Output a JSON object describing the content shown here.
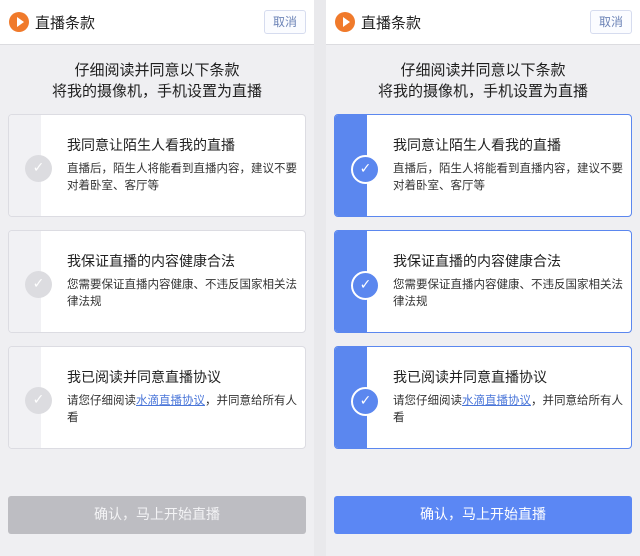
{
  "screens": [
    {
      "state": "unchecked",
      "header": {
        "title": "直播条款",
        "cancel_label": "取消"
      },
      "intro": [
        "仔细阅读并同意以下条款",
        "将我的摄像机，手机设置为直播"
      ],
      "items": [
        {
          "title": "我同意让陌生人看我的直播",
          "desc": "直播后，陌生人将能看到直播内容，建议不要对着卧室、客厅等",
          "checked": false
        },
        {
          "title": "我保证直播的内容健康合法",
          "desc": "您需要保证直播内容健康、不违反国家相关法律法规",
          "checked": false
        },
        {
          "title": "我已阅读并同意直播协议",
          "desc_before": "请您仔细阅读",
          "link": "水滴直播协议",
          "desc_after": "，并同意给所有人看",
          "checked": false
        }
      ],
      "confirm_label": "确认，马上开始直播"
    },
    {
      "state": "checked",
      "header": {
        "title": "直播条款",
        "cancel_label": "取消"
      },
      "intro": [
        "仔细阅读并同意以下条款",
        "将我的摄像机，手机设置为直播"
      ],
      "items": [
        {
          "title": "我同意让陌生人看我的直播",
          "desc": "直播后，陌生人将能看到直播内容，建议不要对着卧室、客厅等",
          "checked": true
        },
        {
          "title": "我保证直播的内容健康合法",
          "desc": "您需要保证直播内容健康、不违反国家相关法律法规",
          "checked": true
        },
        {
          "title": "我已阅读并同意直播协议",
          "desc_before": "请您仔细阅读",
          "link": "水滴直播协议",
          "desc_after": "，并同意给所有人看",
          "checked": true
        }
      ],
      "confirm_label": "确认，马上开始直播"
    }
  ],
  "icons": {
    "logo": "play-logo-icon",
    "check": "checkmark-icon"
  },
  "colors": {
    "accent": "#5b87f4",
    "logo": "#f07a2b",
    "disabled": "#bdbdc2"
  }
}
